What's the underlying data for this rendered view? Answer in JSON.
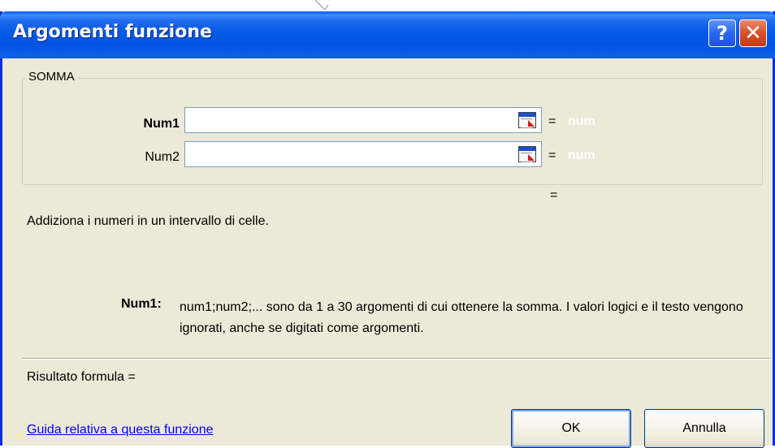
{
  "window": {
    "title": "Argomenti funzione",
    "help_icon": "?",
    "close_icon": "✕"
  },
  "function_group": {
    "legend": "SOMMA",
    "args": [
      {
        "label": "Num1",
        "value": "",
        "result_eq": "=",
        "result": "num"
      },
      {
        "label": "Num2",
        "value": "",
        "result_eq": "=",
        "result": "num"
      }
    ],
    "function_result_eq": "="
  },
  "description": "Addiziona i numeri in un intervallo di celle.",
  "arg_help": {
    "label": "Num1:",
    "text": "num1;num2;... sono da 1 a 30 argomenti di cui ottenere la somma. I valori logici e il testo vengono ignorati, anche se digitati come argomenti."
  },
  "formula_result": "Risultato formula =",
  "help_link": "Guida relativa a questa funzione",
  "buttons": {
    "ok": "OK",
    "cancel": "Annulla"
  },
  "colors": {
    "titlebar": "#0353e3",
    "dialog_bg": "#ece9d8",
    "link": "#0000ff",
    "close_button": "#d6502b"
  }
}
